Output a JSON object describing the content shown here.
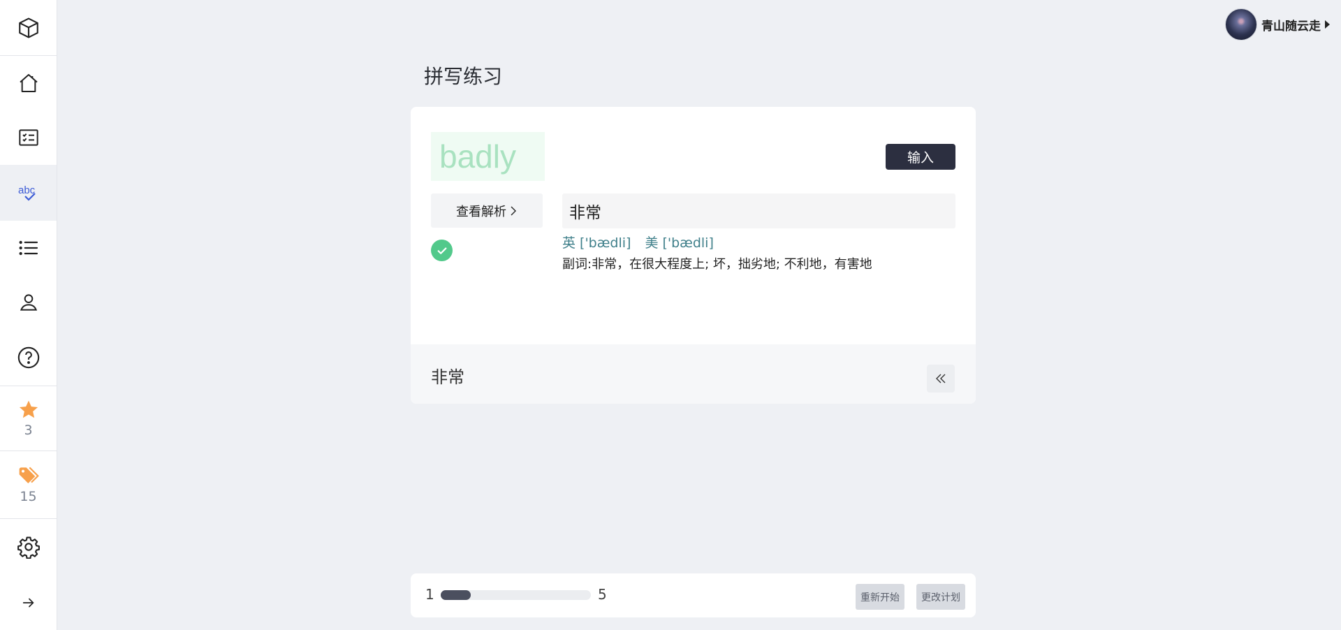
{
  "sidebar": {
    "favorites_count": "3",
    "tags_count": "15"
  },
  "user": {
    "name": "青山随云走"
  },
  "page": {
    "title": "拼写练习"
  },
  "card": {
    "word": "badly",
    "input_button": "输入",
    "analysis_button": "查看解析",
    "answer_value": "非常",
    "phonetic_uk": "英 ['bædli]",
    "phonetic_us": "美 ['bædli]",
    "meaning": "副词:非常，在很大程度上; 坏，拙劣地; 不利地，有害地",
    "footer_word": "非常"
  },
  "progress": {
    "current": "1",
    "total": "5",
    "fraction": 0.2,
    "restart_button": "重新开始",
    "change_plan_button": "更改计划"
  }
}
